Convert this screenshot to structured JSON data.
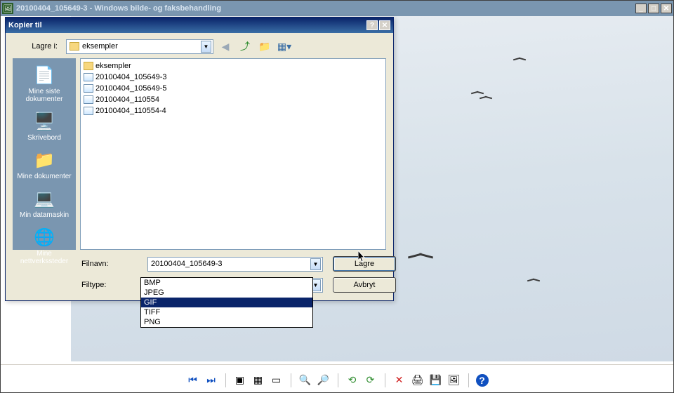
{
  "app": {
    "title": "20100404_105649-3 - Windows bilde- og faksbehandling"
  },
  "dialog": {
    "title": "Kopier til",
    "save_in_label": "Lagre i:",
    "save_in_value": "eksempler",
    "filename_label": "Filnavn:",
    "filename_value": "20100404_105649-3",
    "filetype_label": "Filtype:",
    "filetype_value": "GIF",
    "save_button": "Lagre",
    "cancel_button": "Avbryt",
    "sidebar": [
      {
        "icon": "📄",
        "label": "Mine siste dokumenter"
      },
      {
        "icon": "🖥️",
        "label": "Skrivebord"
      },
      {
        "icon": "📁",
        "label": "Mine dokumenter"
      },
      {
        "icon": "💻",
        "label": "Min datamaskin"
      },
      {
        "icon": "🌐",
        "label": "Mine nettverkssteder"
      }
    ],
    "files": [
      {
        "type": "folder",
        "name": "eksempler"
      },
      {
        "type": "img",
        "name": "20100404_105649-3"
      },
      {
        "type": "img",
        "name": "20100404_105649-5"
      },
      {
        "type": "img",
        "name": "20100404_110554"
      },
      {
        "type": "img",
        "name": "20100404_110554-4"
      }
    ],
    "filetype_options": [
      "BMP",
      "JPEG",
      "GIF",
      "TIFF",
      "PNG"
    ],
    "filetype_selected_index": 2
  },
  "toolbar_icons": {
    "prev": "⏮",
    "next": "⏭",
    "fit": "▣",
    "actual": "▦",
    "slideshow": "▭",
    "zoomin": "🔍",
    "zoomout": "🔎",
    "rotleft": "⟲",
    "rotright": "⟳",
    "delete": "✕",
    "print": "🖨",
    "save": "💾",
    "edit": "🖼",
    "help": "?"
  }
}
